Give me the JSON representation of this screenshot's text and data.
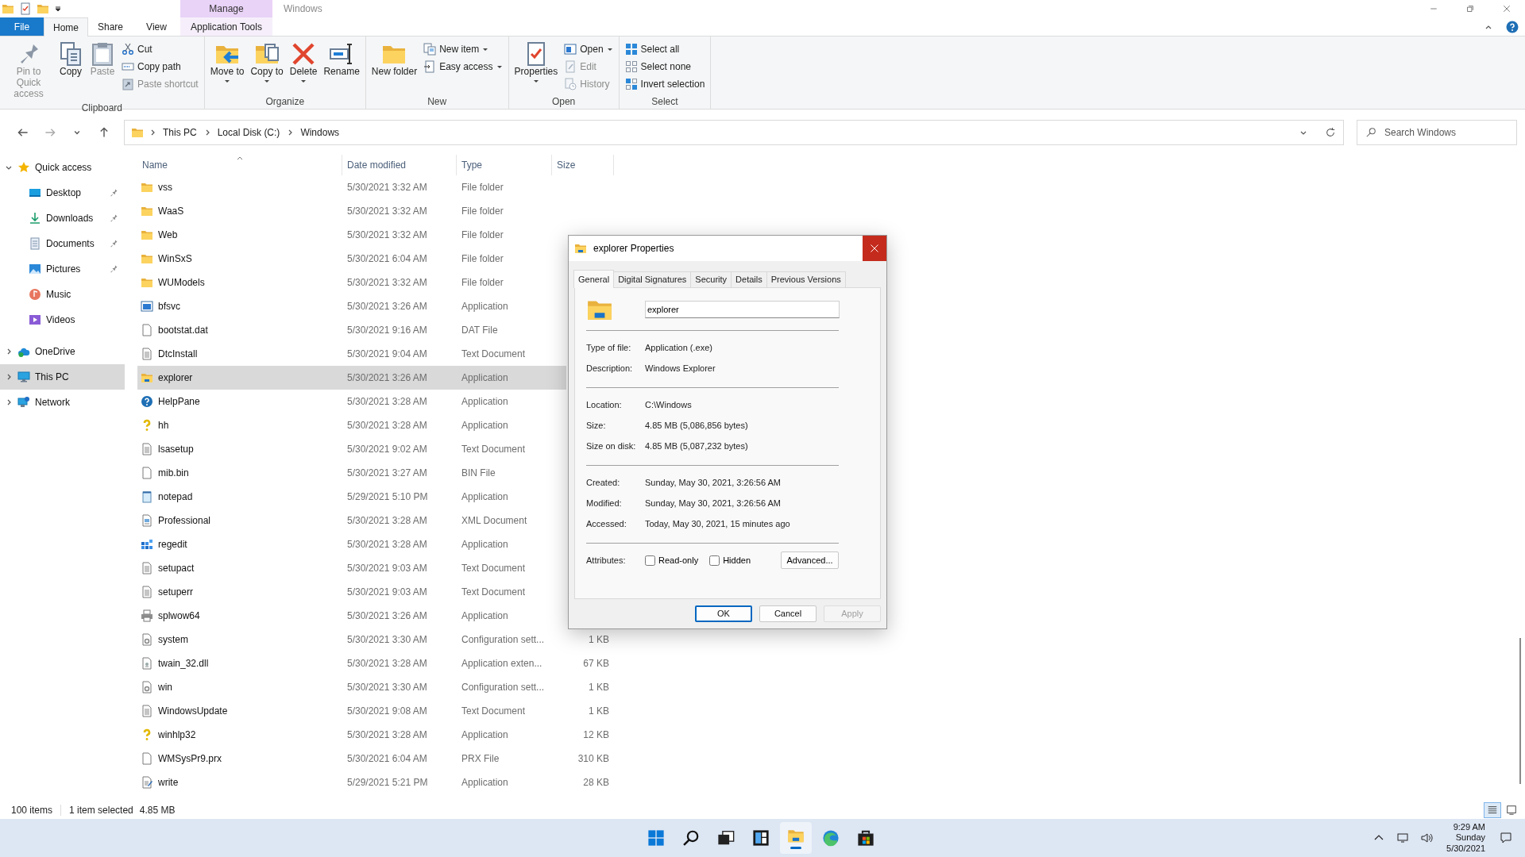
{
  "window": {
    "title": "Windows",
    "context_header": "Manage"
  },
  "ribbon_tabs": [
    {
      "label": "File",
      "kind": "backstage",
      "selected": false
    },
    {
      "label": "Home",
      "kind": "normal",
      "selected": true
    },
    {
      "label": "Share",
      "kind": "normal",
      "selected": false
    },
    {
      "label": "View",
      "kind": "normal",
      "selected": false
    },
    {
      "label": "Application Tools",
      "kind": "contextual",
      "selected": false
    }
  ],
  "ribbon_groups": [
    {
      "label": "Clipboard",
      "items": [
        {
          "label": "Pin to Quick access",
          "kind": "large",
          "disabled": true,
          "dropdown": false
        },
        {
          "label": "Copy",
          "kind": "large",
          "disabled": false,
          "dropdown": false
        },
        {
          "label": "Paste",
          "kind": "large",
          "disabled": true,
          "dropdown": false
        },
        {
          "label": "Cut",
          "kind": "small",
          "disabled": false,
          "dropdown": false
        },
        {
          "label": "Copy path",
          "kind": "small",
          "disabled": false,
          "dropdown": false
        },
        {
          "label": "Paste shortcut",
          "kind": "small",
          "disabled": true,
          "dropdown": false
        }
      ]
    },
    {
      "label": "Organize",
      "items": [
        {
          "label": "Move to",
          "kind": "large",
          "disabled": false,
          "dropdown": true
        },
        {
          "label": "Copy to",
          "kind": "large",
          "disabled": false,
          "dropdown": true
        },
        {
          "label": "Delete",
          "kind": "large",
          "disabled": false,
          "dropdown": true
        },
        {
          "label": "Rename",
          "kind": "large",
          "disabled": false,
          "dropdown": false
        }
      ]
    },
    {
      "label": "New",
      "items": [
        {
          "label": "New folder",
          "kind": "large",
          "disabled": false,
          "dropdown": false
        },
        {
          "label": "New item",
          "kind": "small",
          "disabled": false,
          "dropdown": true
        },
        {
          "label": "Easy access",
          "kind": "small",
          "disabled": false,
          "dropdown": true
        }
      ]
    },
    {
      "label": "Open",
      "items": [
        {
          "label": "Properties",
          "kind": "large",
          "disabled": false,
          "dropdown": true
        },
        {
          "label": "Open",
          "kind": "small",
          "disabled": false,
          "dropdown": true
        },
        {
          "label": "Edit",
          "kind": "small",
          "disabled": true,
          "dropdown": false
        },
        {
          "label": "History",
          "kind": "small",
          "disabled": true,
          "dropdown": false
        }
      ]
    },
    {
      "label": "Select",
      "items": [
        {
          "label": "Select all",
          "kind": "small",
          "disabled": false,
          "dropdown": false
        },
        {
          "label": "Select none",
          "kind": "small",
          "disabled": false,
          "dropdown": false
        },
        {
          "label": "Invert selection",
          "kind": "small",
          "disabled": false,
          "dropdown": false
        }
      ]
    }
  ],
  "address": {
    "breadcrumbs": [
      "This PC",
      "Local Disk (C:)",
      "Windows"
    ]
  },
  "search": {
    "placeholder": "Search Windows"
  },
  "nav": [
    {
      "label": "Quick access",
      "kind": "star",
      "expanded": true,
      "selected": false,
      "children": [
        {
          "label": "Desktop",
          "kind": "desktop",
          "pinned": true
        },
        {
          "label": "Downloads",
          "kind": "download",
          "pinned": true
        },
        {
          "label": "Documents",
          "kind": "document",
          "pinned": true
        },
        {
          "label": "Pictures",
          "kind": "picture",
          "pinned": true
        },
        {
          "label": "Music",
          "kind": "music",
          "pinned": false
        },
        {
          "label": "Videos",
          "kind": "video",
          "pinned": false
        }
      ]
    },
    {
      "label": "OneDrive",
      "kind": "cloud",
      "expanded": false,
      "selected": false
    },
    {
      "label": "This PC",
      "kind": "pc",
      "expanded": false,
      "selected": true
    },
    {
      "label": "Network",
      "kind": "network",
      "expanded": false,
      "selected": false
    }
  ],
  "columns": [
    {
      "label": "Name",
      "sorted": true
    },
    {
      "label": "Date modified",
      "sorted": false
    },
    {
      "label": "Type",
      "sorted": false
    },
    {
      "label": "Size",
      "sorted": false
    }
  ],
  "files": [
    {
      "name": "vss",
      "date": "5/30/2021 3:32 AM",
      "type": "File folder",
      "kind": "folder",
      "selected": false
    },
    {
      "name": "WaaS",
      "date": "5/30/2021 3:32 AM",
      "type": "File folder",
      "kind": "folder",
      "selected": false
    },
    {
      "name": "Web",
      "date": "5/30/2021 3:32 AM",
      "type": "File folder",
      "kind": "folder",
      "selected": false
    },
    {
      "name": "WinSxS",
      "date": "5/30/2021 6:04 AM",
      "type": "File folder",
      "kind": "folder",
      "selected": false
    },
    {
      "name": "WUModels",
      "date": "5/30/2021 3:32 AM",
      "type": "File folder",
      "kind": "folder",
      "selected": false
    },
    {
      "name": "bfsvc",
      "date": "5/30/2021 3:26 AM",
      "type": "Application",
      "kind": "window",
      "selected": false
    },
    {
      "name": "bootstat.dat",
      "date": "5/30/2021 9:16 AM",
      "type": "DAT File",
      "kind": "blank",
      "selected": false
    },
    {
      "name": "DtcInstall",
      "date": "5/30/2021 9:04 AM",
      "type": "Text Document",
      "kind": "text",
      "selected": false
    },
    {
      "name": "explorer",
      "date": "5/30/2021 3:26 AM",
      "type": "Application",
      "kind": "explorer",
      "selected": true
    },
    {
      "name": "HelpPane",
      "date": "5/30/2021 3:28 AM",
      "type": "Application",
      "kind": "help",
      "selected": false
    },
    {
      "name": "hh",
      "date": "5/30/2021 3:28 AM",
      "type": "Application",
      "kind": "question",
      "selected": false
    },
    {
      "name": "lsasetup",
      "date": "5/30/2021 9:02 AM",
      "type": "Text Document",
      "kind": "text",
      "selected": false
    },
    {
      "name": "mib.bin",
      "date": "5/30/2021 3:27 AM",
      "type": "BIN File",
      "kind": "blank",
      "selected": false
    },
    {
      "name": "notepad",
      "date": "5/29/2021 5:10 PM",
      "type": "Application",
      "kind": "notepad",
      "selected": false
    },
    {
      "name": "Professional",
      "date": "5/30/2021 3:28 AM",
      "type": "XML Document",
      "kind": "xml",
      "selected": false
    },
    {
      "name": "regedit",
      "date": "5/30/2021 3:28 AM",
      "type": "Application",
      "kind": "regedit",
      "selected": false
    },
    {
      "name": "setupact",
      "date": "5/30/2021 9:03 AM",
      "type": "Text Document",
      "kind": "text",
      "selected": false
    },
    {
      "name": "setuperr",
      "date": "5/30/2021 9:03 AM",
      "type": "Text Document",
      "kind": "text",
      "selected": false
    },
    {
      "name": "splwow64",
      "date": "5/30/2021 3:26 AM",
      "type": "Application",
      "kind": "printer",
      "selected": false
    },
    {
      "name": "system",
      "date": "5/30/2021 3:30 AM",
      "type": "Configuration sett...",
      "size": "1 KB",
      "kind": "config",
      "selected": false
    },
    {
      "name": "twain_32.dll",
      "date": "5/30/2021 3:28 AM",
      "type": "Application exten...",
      "size": "67 KB",
      "kind": "dll",
      "selected": false
    },
    {
      "name": "win",
      "date": "5/30/2021 3:30 AM",
      "type": "Configuration sett...",
      "size": "1 KB",
      "kind": "config",
      "selected": false
    },
    {
      "name": "WindowsUpdate",
      "date": "5/30/2021 9:08 AM",
      "type": "Text Document",
      "size": "1 KB",
      "kind": "text",
      "selected": false
    },
    {
      "name": "winhlp32",
      "date": "5/30/2021 3:28 AM",
      "type": "Application",
      "size": "12 KB",
      "kind": "question",
      "selected": false
    },
    {
      "name": "WMSysPr9.prx",
      "date": "5/30/2021 6:04 AM",
      "type": "PRX File",
      "size": "310 KB",
      "kind": "blank",
      "selected": false
    },
    {
      "name": "write",
      "date": "5/29/2021 5:21 PM",
      "type": "Application",
      "size": "28 KB",
      "kind": "write",
      "selected": false
    }
  ],
  "status_bar": {
    "item_count": "100 items",
    "selection": "1 item selected",
    "selection_size": "4.85 MB"
  },
  "views": [
    {
      "kind": "details",
      "selected": true
    },
    {
      "kind": "large-icons",
      "selected": false
    }
  ],
  "dialog": {
    "title": "explorer Properties",
    "tabs": [
      {
        "label": "General",
        "selected": true
      },
      {
        "label": "Digital Signatures",
        "selected": false
      },
      {
        "label": "Security",
        "selected": false
      },
      {
        "label": "Details",
        "selected": false
      },
      {
        "label": "Previous Versions",
        "selected": false
      }
    ],
    "name": "explorer",
    "sections": [
      [
        {
          "label": "Type of file:",
          "value": "Application (.exe)"
        },
        {
          "label": "Description:",
          "value": "Windows Explorer"
        }
      ],
      [
        {
          "label": "Location:",
          "value": "C:\\Windows"
        },
        {
          "label": "Size:",
          "value": "4.85 MB (5,086,856 bytes)"
        },
        {
          "label": "Size on disk:",
          "value": "4.85 MB (5,087,232 bytes)"
        }
      ],
      [
        {
          "label": "Created:",
          "value": "Sunday, May 30, 2021, 3:26:56 AM"
        },
        {
          "label": "Modified:",
          "value": "Sunday, May 30, 2021, 3:26:56 AM"
        },
        {
          "label": "Accessed:",
          "value": "Today, May 30, 2021, 15 minutes ago"
        }
      ]
    ],
    "attributes": {
      "label": "Attributes:",
      "options": [
        {
          "label": "Read-only",
          "checked": false
        },
        {
          "label": "Hidden",
          "checked": false
        }
      ],
      "advanced": "Advanced..."
    },
    "buttons": [
      {
        "label": "OK",
        "kind": "default",
        "disabled": false
      },
      {
        "label": "Cancel",
        "kind": "normal",
        "disabled": false
      },
      {
        "label": "Apply",
        "kind": "normal",
        "disabled": true
      }
    ]
  },
  "taskbar": {
    "apps": [
      {
        "kind": "start",
        "active": false
      },
      {
        "kind": "search",
        "active": false
      },
      {
        "kind": "task-view",
        "active": false
      },
      {
        "kind": "widgets",
        "active": false
      },
      {
        "kind": "explorer",
        "active": true
      },
      {
        "kind": "edge",
        "active": false
      },
      {
        "kind": "store",
        "active": false
      }
    ],
    "clock": {
      "time": "9:29 AM",
      "day": "Sunday",
      "date": "5/30/2021"
    }
  }
}
